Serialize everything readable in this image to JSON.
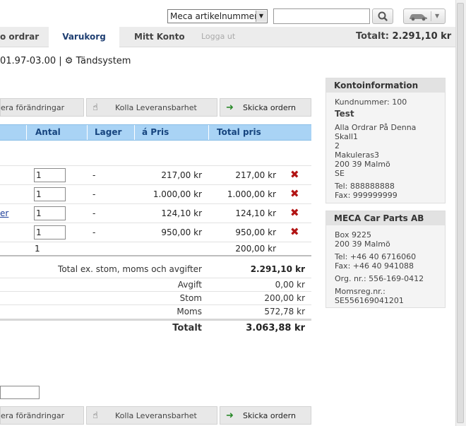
{
  "search": {
    "type_selected": "Meca artikelnummer",
    "query": ""
  },
  "nav": {
    "orders": "o ordrar",
    "cart": "Varukorg",
    "account": "Mitt Konto",
    "logout": "Logga ut",
    "total_label": "Totalt:",
    "total_value": "2.291,10 kr"
  },
  "breadcrumb": {
    "range": "01.97-03.00 |",
    "category": "Tändsystem"
  },
  "actions": {
    "update": "era förändringar",
    "check": "Kolla Leveransbarhet",
    "send": "Skicka ordern"
  },
  "table": {
    "headers": {
      "qty": "Antal",
      "stock": "Lager",
      "unit_price": "á Pris",
      "total": "Total pris"
    },
    "rows": [
      {
        "link": "",
        "qty": "1",
        "stock": "-",
        "price": "217,00 kr",
        "total": "217,00 kr"
      },
      {
        "link": "",
        "qty": "1",
        "stock": "-",
        "price": "1.000,00 kr",
        "total": "1.000,00 kr"
      },
      {
        "link": "er",
        "qty": "1",
        "stock": "-",
        "price": "124,10 kr",
        "total": "124,10 kr"
      },
      {
        "link": "",
        "qty": "1",
        "stock": "-",
        "price": "950,00 kr",
        "total": "950,00 kr"
      }
    ],
    "extra_row": {
      "qty": "1",
      "total": "200,00 kr"
    }
  },
  "summary": {
    "excl_label": "Total ex. stom, moms och avgifter",
    "excl_value": "2.291,10 kr",
    "fee_label": "Avgift",
    "fee_value": "0,00 kr",
    "core_label": "Stom",
    "core_value": "200,00 kr",
    "vat_label": "Moms",
    "vat_value": "572,78 kr",
    "total_label": "Totalt",
    "total_value": "3.063,88 kr"
  },
  "account_box": {
    "title": "Kontoinformation",
    "customer_no": "Kundnummer: 100",
    "name": "Test",
    "lines": [
      "Alla Ordrar På Denna",
      "Skall1",
      "2",
      "Makuleras3",
      "200 39 Malmö",
      "SE"
    ],
    "phone": "Tel: 888888888",
    "fax": "Fax: 999999999"
  },
  "company_box": {
    "title": "MECA Car Parts AB",
    "address": [
      "Box 9225",
      "200 39 Malmö"
    ],
    "phone": "Tel: +46 40 6716060",
    "fax": "Fax: +46 40 941088",
    "org": "Org. nr.: 556-169-0412",
    "vat_label": "Momsreg.nr.:",
    "vat_no": "SE556169041201"
  },
  "bottom_input": ""
}
